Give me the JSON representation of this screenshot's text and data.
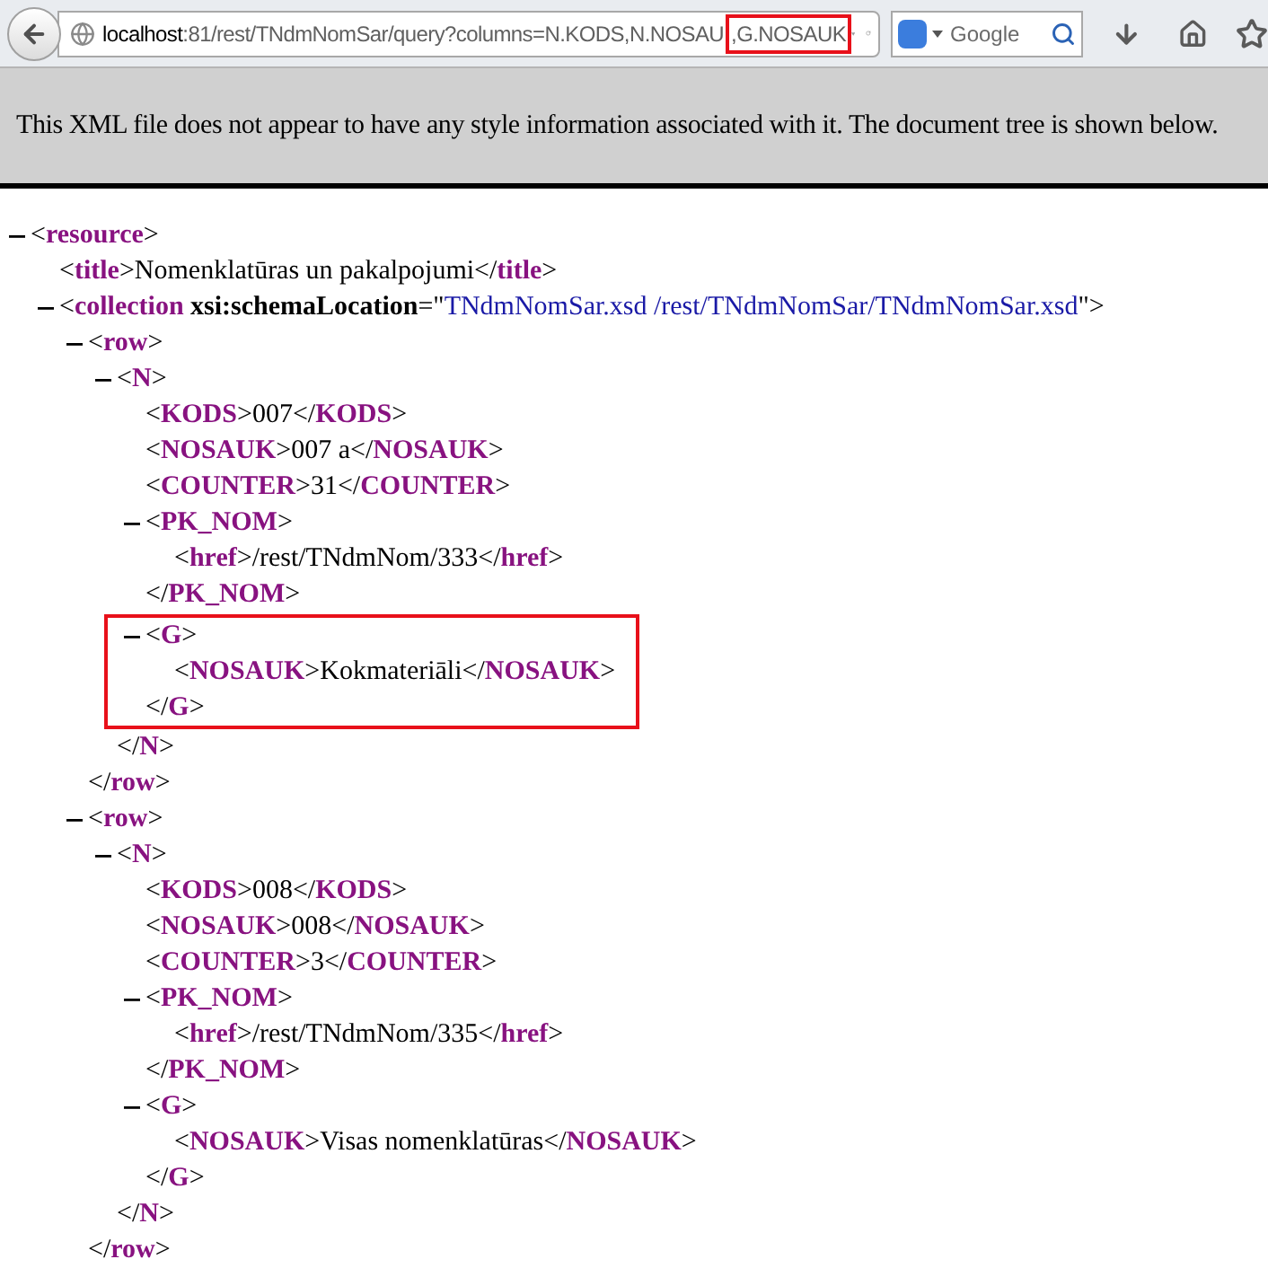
{
  "toolbar": {
    "url_host": "localhost",
    "url_rest": ":81/rest/TNdmNomSar/query?columns=N.KODS,N.NOSAU",
    "url_highlight": ",G.NOSAUK",
    "search": {
      "placeholder": "Google"
    }
  },
  "banner": "This XML file does not appear to have any style information associated with it. The document tree is shown below.",
  "tree": [
    {
      "line": "<**resource**>",
      "expanded": true,
      "children": [
        {
          "line": "<**title**>Nomenklatūras un pakalpojumi</**title**>"
        },
        {
          "parts": [
            {
              "kind": "markup",
              "text": "<**collection** "
            },
            {
              "kind": "attr",
              "text": "xsi:schemaLocation"
            },
            {
              "kind": "markup",
              "text": "=\""
            },
            {
              "kind": "value",
              "text": "TNdmNomSar.xsd /rest/TNdmNomSar/TNdmNomSar.xsd"
            },
            {
              "kind": "markup",
              "text": "\">"
            }
          ],
          "expanded": true,
          "children": [
            {
              "line": "<**row**>",
              "expanded": true,
              "close": "</**row**>",
              "children": [
                {
                  "line": "<**N**>",
                  "expanded": true,
                  "close": "</**N**>",
                  "children": [
                    {
                      "line": "<**KODS**>007</**KODS**>"
                    },
                    {
                      "line": "<**NOSAUK**>007 a</**NOSAUK**>"
                    },
                    {
                      "line": "<**COUNTER**>31</**COUNTER**>"
                    },
                    {
                      "line": "<**PK_NOM**>",
                      "expanded": true,
                      "close": "</**PK_NOM**>",
                      "children": [
                        {
                          "line": "<**href**>/rest/TNdmNom/333</**href**>"
                        }
                      ]
                    },
                    {
                      "line": "<**G**>",
                      "expanded": true,
                      "highlighted": true,
                      "close": "</**G**>",
                      "children": [
                        {
                          "line": "<**NOSAUK**>Kokmateriāli</**NOSAUK**>"
                        }
                      ]
                    }
                  ]
                }
              ]
            },
            {
              "line": "<**row**>",
              "expanded": true,
              "close": "</**row**>",
              "children": [
                {
                  "line": "<**N**>",
                  "expanded": true,
                  "close": "</**N**>",
                  "children": [
                    {
                      "line": "<**KODS**>008</**KODS**>"
                    },
                    {
                      "line": "<**NOSAUK**>008</**NOSAUK**>"
                    },
                    {
                      "line": "<**COUNTER**>3</**COUNTER**>"
                    },
                    {
                      "line": "<**PK_NOM**>",
                      "expanded": true,
                      "close": "</**PK_NOM**>",
                      "children": [
                        {
                          "line": "<**href**>/rest/TNdmNom/335</**href**>"
                        }
                      ]
                    },
                    {
                      "line": "<**G**>",
                      "expanded": true,
                      "highlighted": false,
                      "close": "</**G**>",
                      "children": [
                        {
                          "line": "<**NOSAUK**>Visas nomenklatūras</**NOSAUK**>"
                        }
                      ]
                    }
                  ]
                }
              ]
            }
          ]
        }
      ]
    }
  ]
}
